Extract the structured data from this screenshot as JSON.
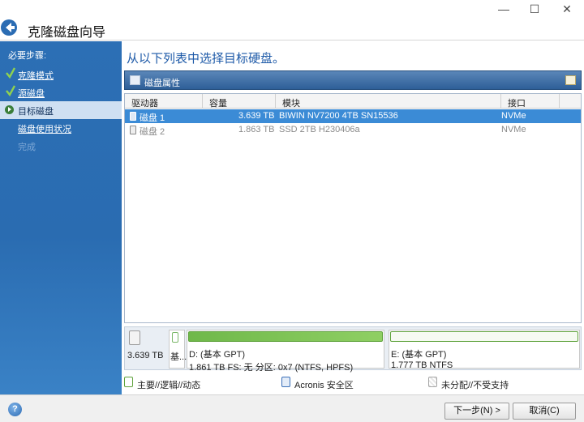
{
  "window": {
    "title": "克隆磁盘向导",
    "controls": {
      "minimize": "—",
      "maximize": "☐",
      "close": "✕"
    }
  },
  "sidebar": {
    "heading": "必要步骤:",
    "steps": [
      {
        "label": "克隆模式",
        "state": "done"
      },
      {
        "label": "源磁盘",
        "state": "done"
      },
      {
        "label": "目标磁盘",
        "state": "current"
      },
      {
        "label": "磁盘使用状况",
        "state": "pending"
      },
      {
        "label": "完成",
        "state": "disabled"
      }
    ]
  },
  "main": {
    "instruction": "从以下列表中选择目标硬盘。",
    "toolbar": {
      "properties_label": "磁盘属性"
    },
    "table": {
      "columns": [
        "驱动器",
        "容量",
        "模块",
        "接口"
      ],
      "rows": [
        {
          "drive": "磁盘 1",
          "capacity": "3.639 TB",
          "model": "BIWIN NV7200 4TB SN15536",
          "interface": "NVMe",
          "selected": true
        },
        {
          "drive": "磁盘 2",
          "capacity": "1.863 TB",
          "model": "SSD 2TB H230406a",
          "interface": "NVMe",
          "selected": false
        }
      ]
    },
    "diskmap": {
      "disk_size": "3.639 TB",
      "basic_label": "基...",
      "partitions": [
        {
          "name": "D: (基本 GPT)",
          "details": "1.861 TB  FS: 无 分区: 0x7 (NTFS, HPFS)",
          "fill_fraction": 1.0
        },
        {
          "name": "E: (基本 GPT)",
          "details": "1.777 TB   NTFS",
          "fill_fraction": 0.0
        }
      ]
    },
    "legend": [
      {
        "label": "主要//逻辑//动态",
        "color": "#6fb84a"
      },
      {
        "label": "Acronis 安全区",
        "color": "#3a6fb8"
      },
      {
        "label": "未分配//不受支持",
        "color": "#d0d0d0"
      }
    ]
  },
  "footer": {
    "help_icon": "?",
    "next_label": "下一步(N) >",
    "cancel_label": "取消(C)"
  },
  "colors": {
    "sidebar": "#2c6fb5",
    "selection": "#3b8bd6",
    "partition_green": "#6fb84a",
    "instruction_blue": "#1e5aa8"
  }
}
